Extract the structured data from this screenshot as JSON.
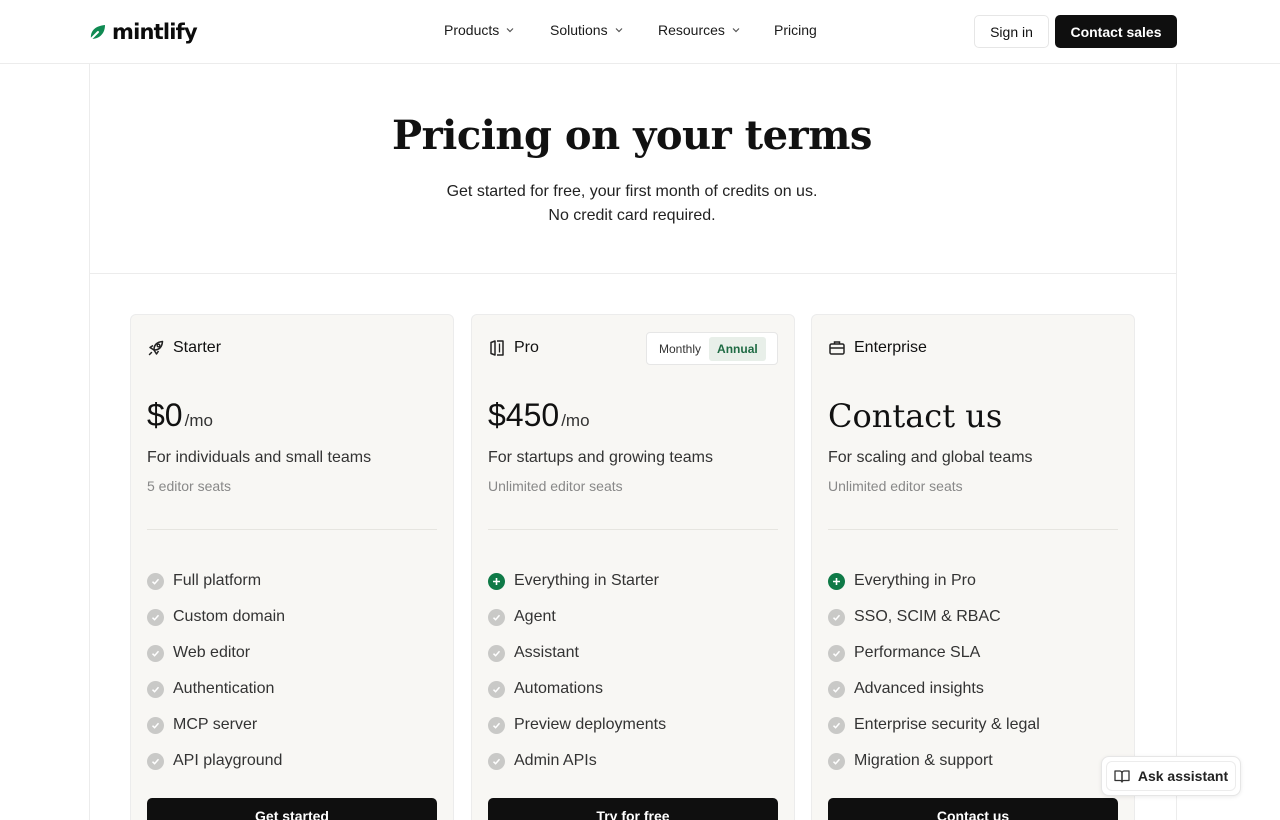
{
  "header": {
    "logo_text": "mintlify",
    "nav": [
      {
        "label": "Products",
        "has_dropdown": true
      },
      {
        "label": "Solutions",
        "has_dropdown": true
      },
      {
        "label": "Resources",
        "has_dropdown": true
      },
      {
        "label": "Pricing",
        "has_dropdown": false
      }
    ],
    "sign_in_label": "Sign in",
    "contact_sales_label": "Contact sales"
  },
  "hero": {
    "title": "Pricing on your terms",
    "subtitle_line1": "Get started for free, your first month of credits on us.",
    "subtitle_line2": "No credit card required."
  },
  "plans": [
    {
      "name": "Starter",
      "icon": "rocket-icon",
      "price": "$0",
      "unit": "/mo",
      "tagline": "For individuals and small teams",
      "seats": "5 editor seats",
      "features": [
        {
          "label": "Full platform",
          "kind": "check"
        },
        {
          "label": "Custom domain",
          "kind": "check"
        },
        {
          "label": "Web editor",
          "kind": "check"
        },
        {
          "label": "Authentication",
          "kind": "check"
        },
        {
          "label": "MCP server",
          "kind": "check"
        },
        {
          "label": "API playground",
          "kind": "check"
        }
      ],
      "cta": "Get started"
    },
    {
      "name": "Pro",
      "icon": "columns-icon",
      "billing_toggle": {
        "options": [
          "Monthly",
          "Annual"
        ],
        "selected": "Annual"
      },
      "price": "$450",
      "unit": "/mo",
      "tagline": "For startups and growing teams",
      "seats": "Unlimited editor seats",
      "features": [
        {
          "label": "Everything in Starter",
          "kind": "plus"
        },
        {
          "label": "Agent",
          "kind": "check"
        },
        {
          "label": "Assistant",
          "kind": "check"
        },
        {
          "label": "Automations",
          "kind": "check"
        },
        {
          "label": "Preview deployments",
          "kind": "check"
        },
        {
          "label": "Admin APIs",
          "kind": "check"
        }
      ],
      "cta": "Try for free"
    },
    {
      "name": "Enterprise",
      "icon": "briefcase-icon",
      "price": "Contact us",
      "unit": "",
      "tagline": "For scaling and global teams",
      "seats": "Unlimited editor seats",
      "features": [
        {
          "label": "Everything in Pro",
          "kind": "plus"
        },
        {
          "label": "SSO, SCIM & RBAC",
          "kind": "check"
        },
        {
          "label": "Performance SLA",
          "kind": "check"
        },
        {
          "label": "Advanced insights",
          "kind": "check"
        },
        {
          "label": "Enterprise security & legal",
          "kind": "check"
        },
        {
          "label": "Migration & support",
          "kind": "check"
        }
      ],
      "cta": "Contact us"
    }
  ],
  "assistant_button": {
    "label": "Ask assistant",
    "icon": "book-icon"
  },
  "colors": {
    "accent_green": "#0f7a47",
    "dark": "#0f0f0f",
    "card_bg": "#f8f7f4"
  }
}
